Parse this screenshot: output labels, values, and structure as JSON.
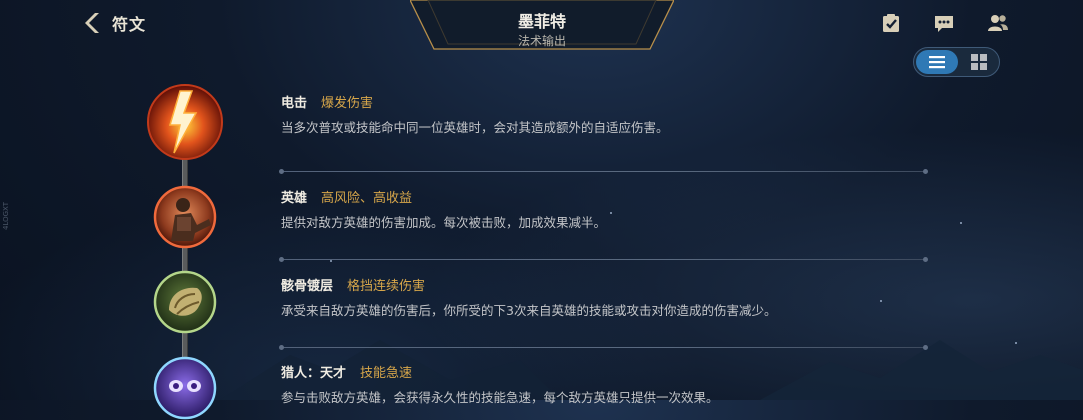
{
  "header": {
    "back_label": "符文",
    "champion_name": "墨菲特",
    "champion_role": "法术输出",
    "icons": [
      "checklist-icon",
      "chat-icon",
      "friends-icon"
    ]
  },
  "view_toggle": {
    "selected": "list",
    "options": [
      "list",
      "grid"
    ]
  },
  "side_watermark": "4LOGXT",
  "runes": [
    {
      "name": "电击",
      "tag": "爆发伤害",
      "desc": "当多次普攻或技能命中同一位英雄时，会对其造成额外的自适应伤害。",
      "icon": "lightning-rune-icon"
    },
    {
      "name": "英雄",
      "tag": "高风险、高收益",
      "desc": "提供对敌方英雄的伤害加成。每次被击败，加成效果减半。",
      "icon": "warrior-rune-icon"
    },
    {
      "name": "骸骨镀层",
      "tag": "格挡连续伤害",
      "desc": "承受来自敌方英雄的伤害后，你所受的下3次来自英雄的技能或攻击对你造成的伤害减少。",
      "icon": "bone-plating-rune-icon"
    },
    {
      "name": "猎人：天才",
      "tag": "技能急速",
      "desc": "参与击败敌方英雄，会获得永久性的技能急速，每个敌方英雄只提供一次效果。",
      "icon": "owl-rune-icon"
    }
  ],
  "colors": {
    "accent_gold": "#d6a64a",
    "toggle_active": "#2f79b5"
  }
}
